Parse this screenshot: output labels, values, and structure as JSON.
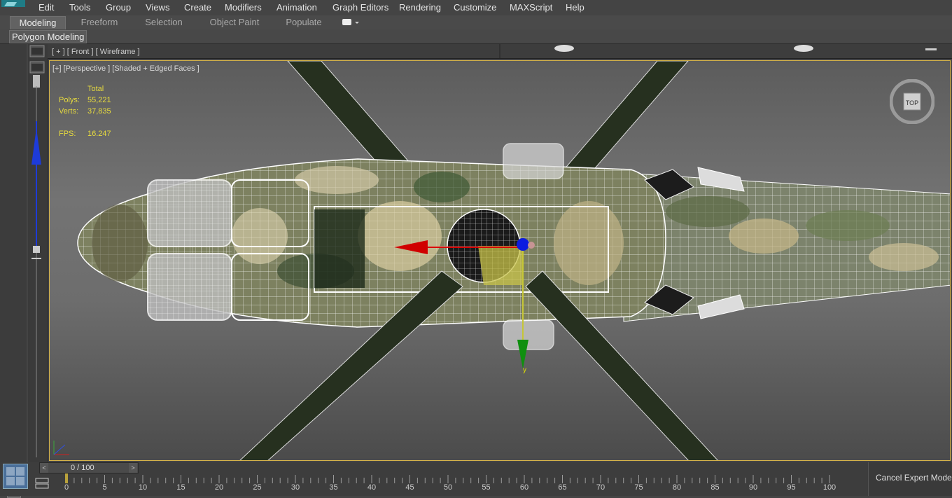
{
  "menu": [
    "Edit",
    "Tools",
    "Group",
    "Views",
    "Create",
    "Modifiers",
    "Animation",
    "Graph Editors",
    "Rendering",
    "Customize",
    "MAXScript",
    "Help"
  ],
  "ribbon": {
    "tabs": [
      "Modeling",
      "Freeform",
      "Selection",
      "Object Paint",
      "Populate"
    ],
    "active_tab": "Modeling",
    "panel_label": "Polygon Modeling"
  },
  "viewport_front": {
    "label": "[ + ] [ Front ] [ Wireframe ]"
  },
  "viewport_persp": {
    "label": "[+] [Perspective ] [Shaded + Edged Faces ]",
    "stats": {
      "header": "Total",
      "polys_label": "Polys:",
      "polys_value": "55,221",
      "verts_label": "Verts:",
      "verts_value": "37,835",
      "fps_label": "FPS:",
      "fps_value": "16.247"
    },
    "viewcube_label": "TOP",
    "gizmo_y_label": "y"
  },
  "timeline": {
    "frame_text": "0 / 100",
    "current": 0,
    "start": 0,
    "end": 100,
    "ticks": [
      "5",
      "10",
      "15",
      "20",
      "25",
      "30",
      "35",
      "40",
      "45",
      "50",
      "55",
      "60",
      "65",
      "70",
      "75",
      "80",
      "85",
      "90",
      "95",
      "100"
    ]
  },
  "expert_mode": {
    "label": "Cancel Expert Mode"
  },
  "colors": {
    "viewport_border": "#d5b34a",
    "stats_text": "#e8dc3e",
    "accent_blue": "#4a6f9a"
  }
}
